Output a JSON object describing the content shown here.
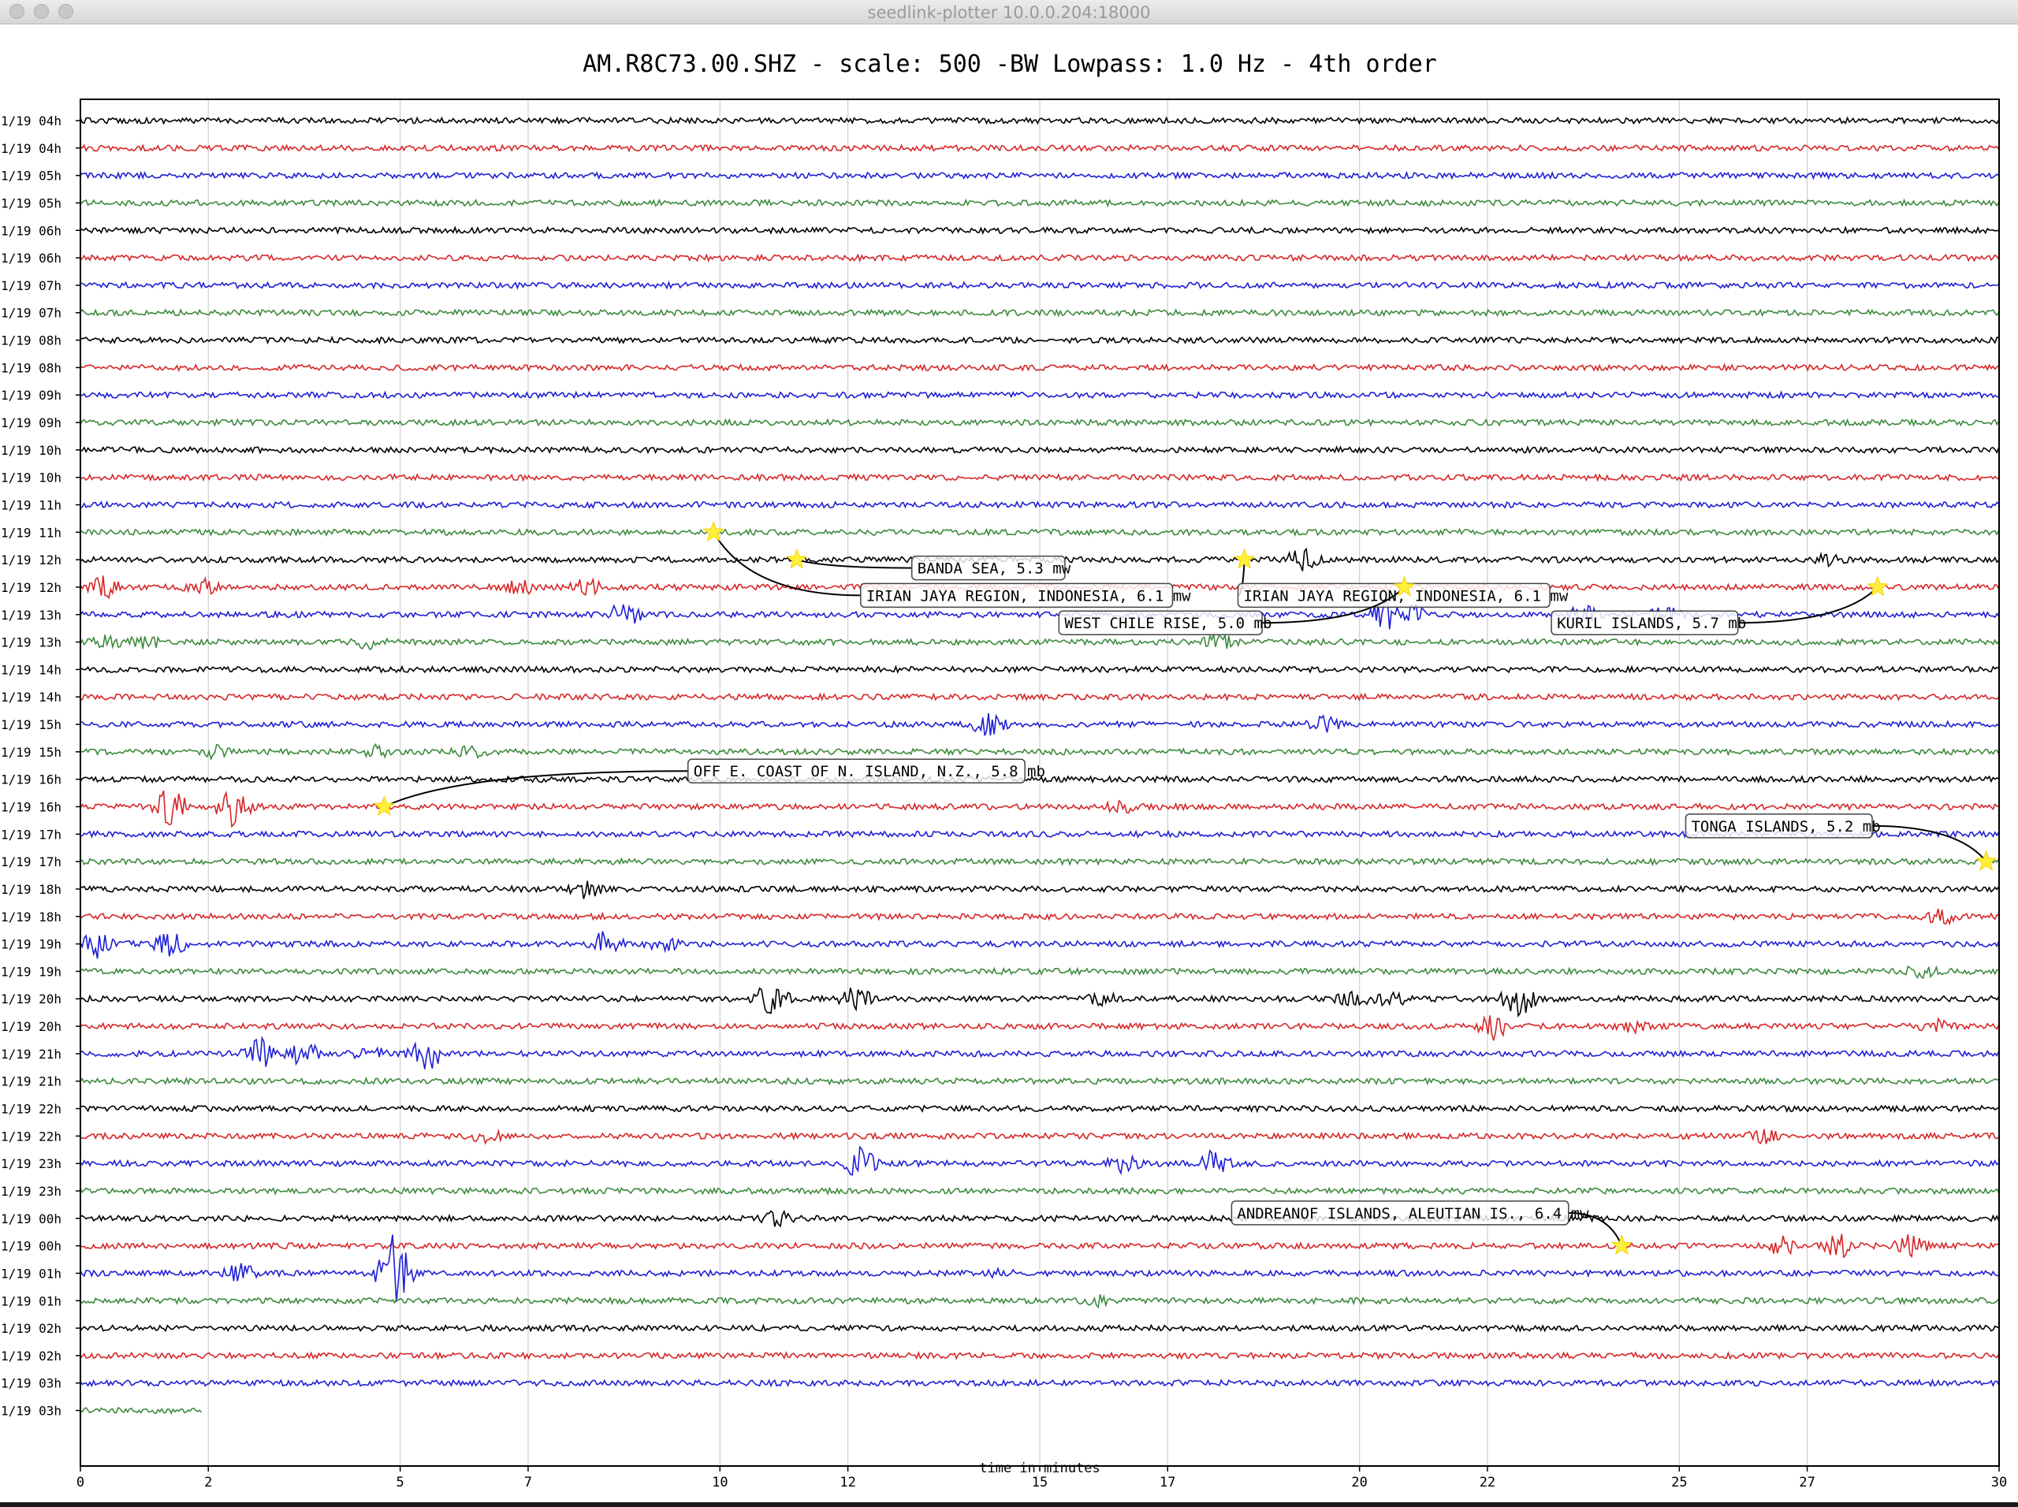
{
  "window": {
    "title": "seedlink-plotter 10.0.0.204:18000",
    "controls": [
      "close-button",
      "minimize-button",
      "zoom-button"
    ]
  },
  "chart_data": {
    "type": "line",
    "title": "AM.R8C73.00.SHZ - scale: 500 -BW Lowpass: 1.0 Hz - 4th order",
    "xlabel": "time in minutes",
    "ylabel": "",
    "xlim": [
      0,
      30
    ],
    "x_ticks": [
      0,
      2,
      5,
      7,
      10,
      12,
      15,
      17,
      20,
      22,
      25,
      27,
      30
    ],
    "grid": true,
    "trace_colors": [
      "#000000",
      "#d62728",
      "#1f1fd6",
      "#3d8a3d"
    ],
    "row_labels": [
      "1/19 04h",
      "1/19 04h",
      "1/19 05h",
      "1/19 05h",
      "1/19 06h",
      "1/19 06h",
      "1/19 07h",
      "1/19 07h",
      "1/19 08h",
      "1/19 08h",
      "1/19 09h",
      "1/19 09h",
      "1/19 10h",
      "1/19 10h",
      "1/19 11h",
      "1/19 11h",
      "1/19 12h",
      "1/19 12h",
      "1/19 13h",
      "1/19 13h",
      "1/19 14h",
      "1/19 14h",
      "1/19 15h",
      "1/19 15h",
      "1/19 16h",
      "1/19 16h",
      "1/19 17h",
      "1/19 17h",
      "1/19 18h",
      "1/19 18h",
      "1/19 19h",
      "1/19 19h",
      "1/19 20h",
      "1/19 20h",
      "1/19 21h",
      "1/19 21h",
      "1/19 22h",
      "1/19 22h",
      "1/19 23h",
      "1/19 23h",
      "1/19 00h",
      "1/19 00h",
      "1/19 01h",
      "1/19 01h",
      "1/19 02h",
      "1/19 02h",
      "1/19 03h",
      "1/19 03h"
    ],
    "last_row_end_minute": 1.9,
    "bursts": [
      {
        "row": 16,
        "x": 19.1,
        "amp": 0.9
      },
      {
        "row": 16,
        "x": 27.3,
        "amp": 0.5
      },
      {
        "row": 17,
        "x": 0.4,
        "amp": 0.9
      },
      {
        "row": 17,
        "x": 1.9,
        "amp": 0.6
      },
      {
        "row": 17,
        "x": 6.9,
        "amp": 0.5
      },
      {
        "row": 17,
        "x": 7.9,
        "amp": 0.6
      },
      {
        "row": 18,
        "x": 8.5,
        "amp": 1.0
      },
      {
        "row": 18,
        "x": 20.4,
        "amp": 1.2
      },
      {
        "row": 18,
        "x": 20.8,
        "amp": 0.9
      },
      {
        "row": 18,
        "x": 23.5,
        "amp": 0.6
      },
      {
        "row": 18,
        "x": 24.8,
        "amp": 0.6
      },
      {
        "row": 19,
        "x": 0.4,
        "amp": 0.4
      },
      {
        "row": 19,
        "x": 1.0,
        "amp": 0.5
      },
      {
        "row": 19,
        "x": 4.5,
        "amp": 0.4
      },
      {
        "row": 19,
        "x": 17.8,
        "amp": 0.5
      },
      {
        "row": 22,
        "x": 14.2,
        "amp": 0.8
      },
      {
        "row": 22,
        "x": 19.4,
        "amp": 0.6
      },
      {
        "row": 23,
        "x": 2.1,
        "amp": 0.4
      },
      {
        "row": 23,
        "x": 4.6,
        "amp": 0.4
      },
      {
        "row": 23,
        "x": 6.1,
        "amp": 0.4
      },
      {
        "row": 25,
        "x": 1.4,
        "amp": 1.4
      },
      {
        "row": 25,
        "x": 2.4,
        "amp": 1.5
      },
      {
        "row": 25,
        "x": 16.3,
        "amp": 0.4
      },
      {
        "row": 28,
        "x": 7.9,
        "amp": 0.6
      },
      {
        "row": 29,
        "x": 29.1,
        "amp": 0.5
      },
      {
        "row": 30,
        "x": 0.2,
        "amp": 1.1
      },
      {
        "row": 30,
        "x": 1.4,
        "amp": 1.1
      },
      {
        "row": 30,
        "x": 8.2,
        "amp": 0.9
      },
      {
        "row": 30,
        "x": 9.1,
        "amp": 0.5
      },
      {
        "row": 31,
        "x": 28.8,
        "amp": 0.5
      },
      {
        "row": 32,
        "x": 10.8,
        "amp": 1.2
      },
      {
        "row": 32,
        "x": 12.1,
        "amp": 0.8
      },
      {
        "row": 32,
        "x": 16.0,
        "amp": 0.5
      },
      {
        "row": 32,
        "x": 19.9,
        "amp": 0.5
      },
      {
        "row": 32,
        "x": 20.5,
        "amp": 0.6
      },
      {
        "row": 32,
        "x": 22.5,
        "amp": 1.3
      },
      {
        "row": 33,
        "x": 22.1,
        "amp": 0.9
      },
      {
        "row": 33,
        "x": 24.3,
        "amp": 0.4
      },
      {
        "row": 33,
        "x": 29.0,
        "amp": 0.5
      },
      {
        "row": 34,
        "x": 2.8,
        "amp": 1.1
      },
      {
        "row": 34,
        "x": 3.5,
        "amp": 0.9
      },
      {
        "row": 34,
        "x": 4.5,
        "amp": 0.5
      },
      {
        "row": 34,
        "x": 5.4,
        "amp": 1.3
      },
      {
        "row": 37,
        "x": 6.3,
        "amp": 0.5
      },
      {
        "row": 37,
        "x": 26.3,
        "amp": 0.5
      },
      {
        "row": 38,
        "x": 12.2,
        "amp": 1.2
      },
      {
        "row": 38,
        "x": 16.3,
        "amp": 0.6
      },
      {
        "row": 38,
        "x": 17.7,
        "amp": 0.9
      },
      {
        "row": 40,
        "x": 10.9,
        "amp": 0.5
      },
      {
        "row": 41,
        "x": 26.6,
        "amp": 0.6
      },
      {
        "row": 41,
        "x": 27.5,
        "amp": 0.8
      },
      {
        "row": 41,
        "x": 28.6,
        "amp": 0.7
      },
      {
        "row": 42,
        "x": 2.5,
        "amp": 0.6
      },
      {
        "row": 42,
        "x": 4.9,
        "amp": 3.0
      },
      {
        "row": 42,
        "x": 14.3,
        "amp": 0.3
      },
      {
        "row": 43,
        "x": 15.9,
        "amp": 0.3
      }
    ],
    "events": [
      {
        "label": "BANDA SEA, 5.3 mw",
        "star_x": 11.2,
        "star_row": 16,
        "box_x": 13.0,
        "box_row": 16.3
      },
      {
        "label": "IRIAN JAYA REGION, INDONESIA, 6.1 mw",
        "star_x": 18.2,
        "star_row": 16,
        "box_x": 18.1,
        "box_row": 17.3
      },
      {
        "label": "IRIAN JAYA REGION, INDONESIA, 6.1 mw",
        "star_x": 9.9,
        "star_row": 15,
        "box_x": 12.2,
        "box_row": 17.3
      },
      {
        "label": "WEST CHILE RISE, 5.0 mb",
        "star_x": 20.7,
        "star_row": 17,
        "box_x": 15.3,
        "box_row": 18.3
      },
      {
        "label": "KURIL ISLANDS, 5.7 mb",
        "star_x": 28.1,
        "star_row": 17,
        "box_x": 23.0,
        "box_row": 18.3
      },
      {
        "label": "OFF E. COAST OF N. ISLAND, N.Z., 5.8 mb",
        "star_x": 4.75,
        "star_row": 25,
        "box_x": 9.5,
        "box_row": 23.7
      },
      {
        "label": "TONGA ISLANDS, 5.2 mb",
        "star_x": 29.8,
        "star_row": 27,
        "box_x": 25.1,
        "box_row": 25.7
      },
      {
        "label": "ANDREANOF ISLANDS, ALEUTIAN IS., 6.4 mw",
        "star_x": 24.1,
        "star_row": 41,
        "box_x": 18.0,
        "box_row": 39.8
      }
    ]
  }
}
